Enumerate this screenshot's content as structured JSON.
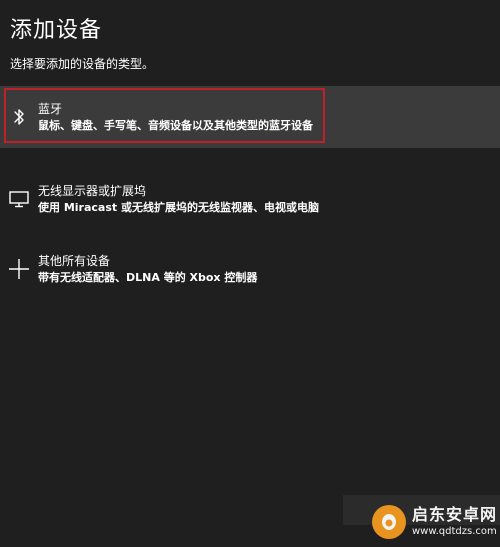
{
  "dialog": {
    "title": "添加设备",
    "subtitle": "选择要添加的设备的类型。"
  },
  "devices": [
    {
      "icon": "bluetooth-icon",
      "name": "蓝牙",
      "description": "鼠标、键盘、手写笔、音频设备以及其他类型的蓝牙设备",
      "selected": true
    },
    {
      "icon": "monitor-icon",
      "name": "无线显示器或扩展坞",
      "description": "使用 Miracast 或无线扩展坞的无线监视器、电视或电脑",
      "selected": false
    },
    {
      "icon": "plus-icon",
      "name": "其他所有设备",
      "description": "带有无线适配器、DLNA 等的 Xbox 控制器",
      "selected": false
    }
  ],
  "watermark": {
    "title": "启东安卓网",
    "url": "www.qdtdzs.com"
  },
  "colors": {
    "background": "#1f1f1f",
    "selected_row": "#3b3b3b",
    "highlight_border": "#c0202a",
    "watermark_orange": "#f39a1f"
  }
}
